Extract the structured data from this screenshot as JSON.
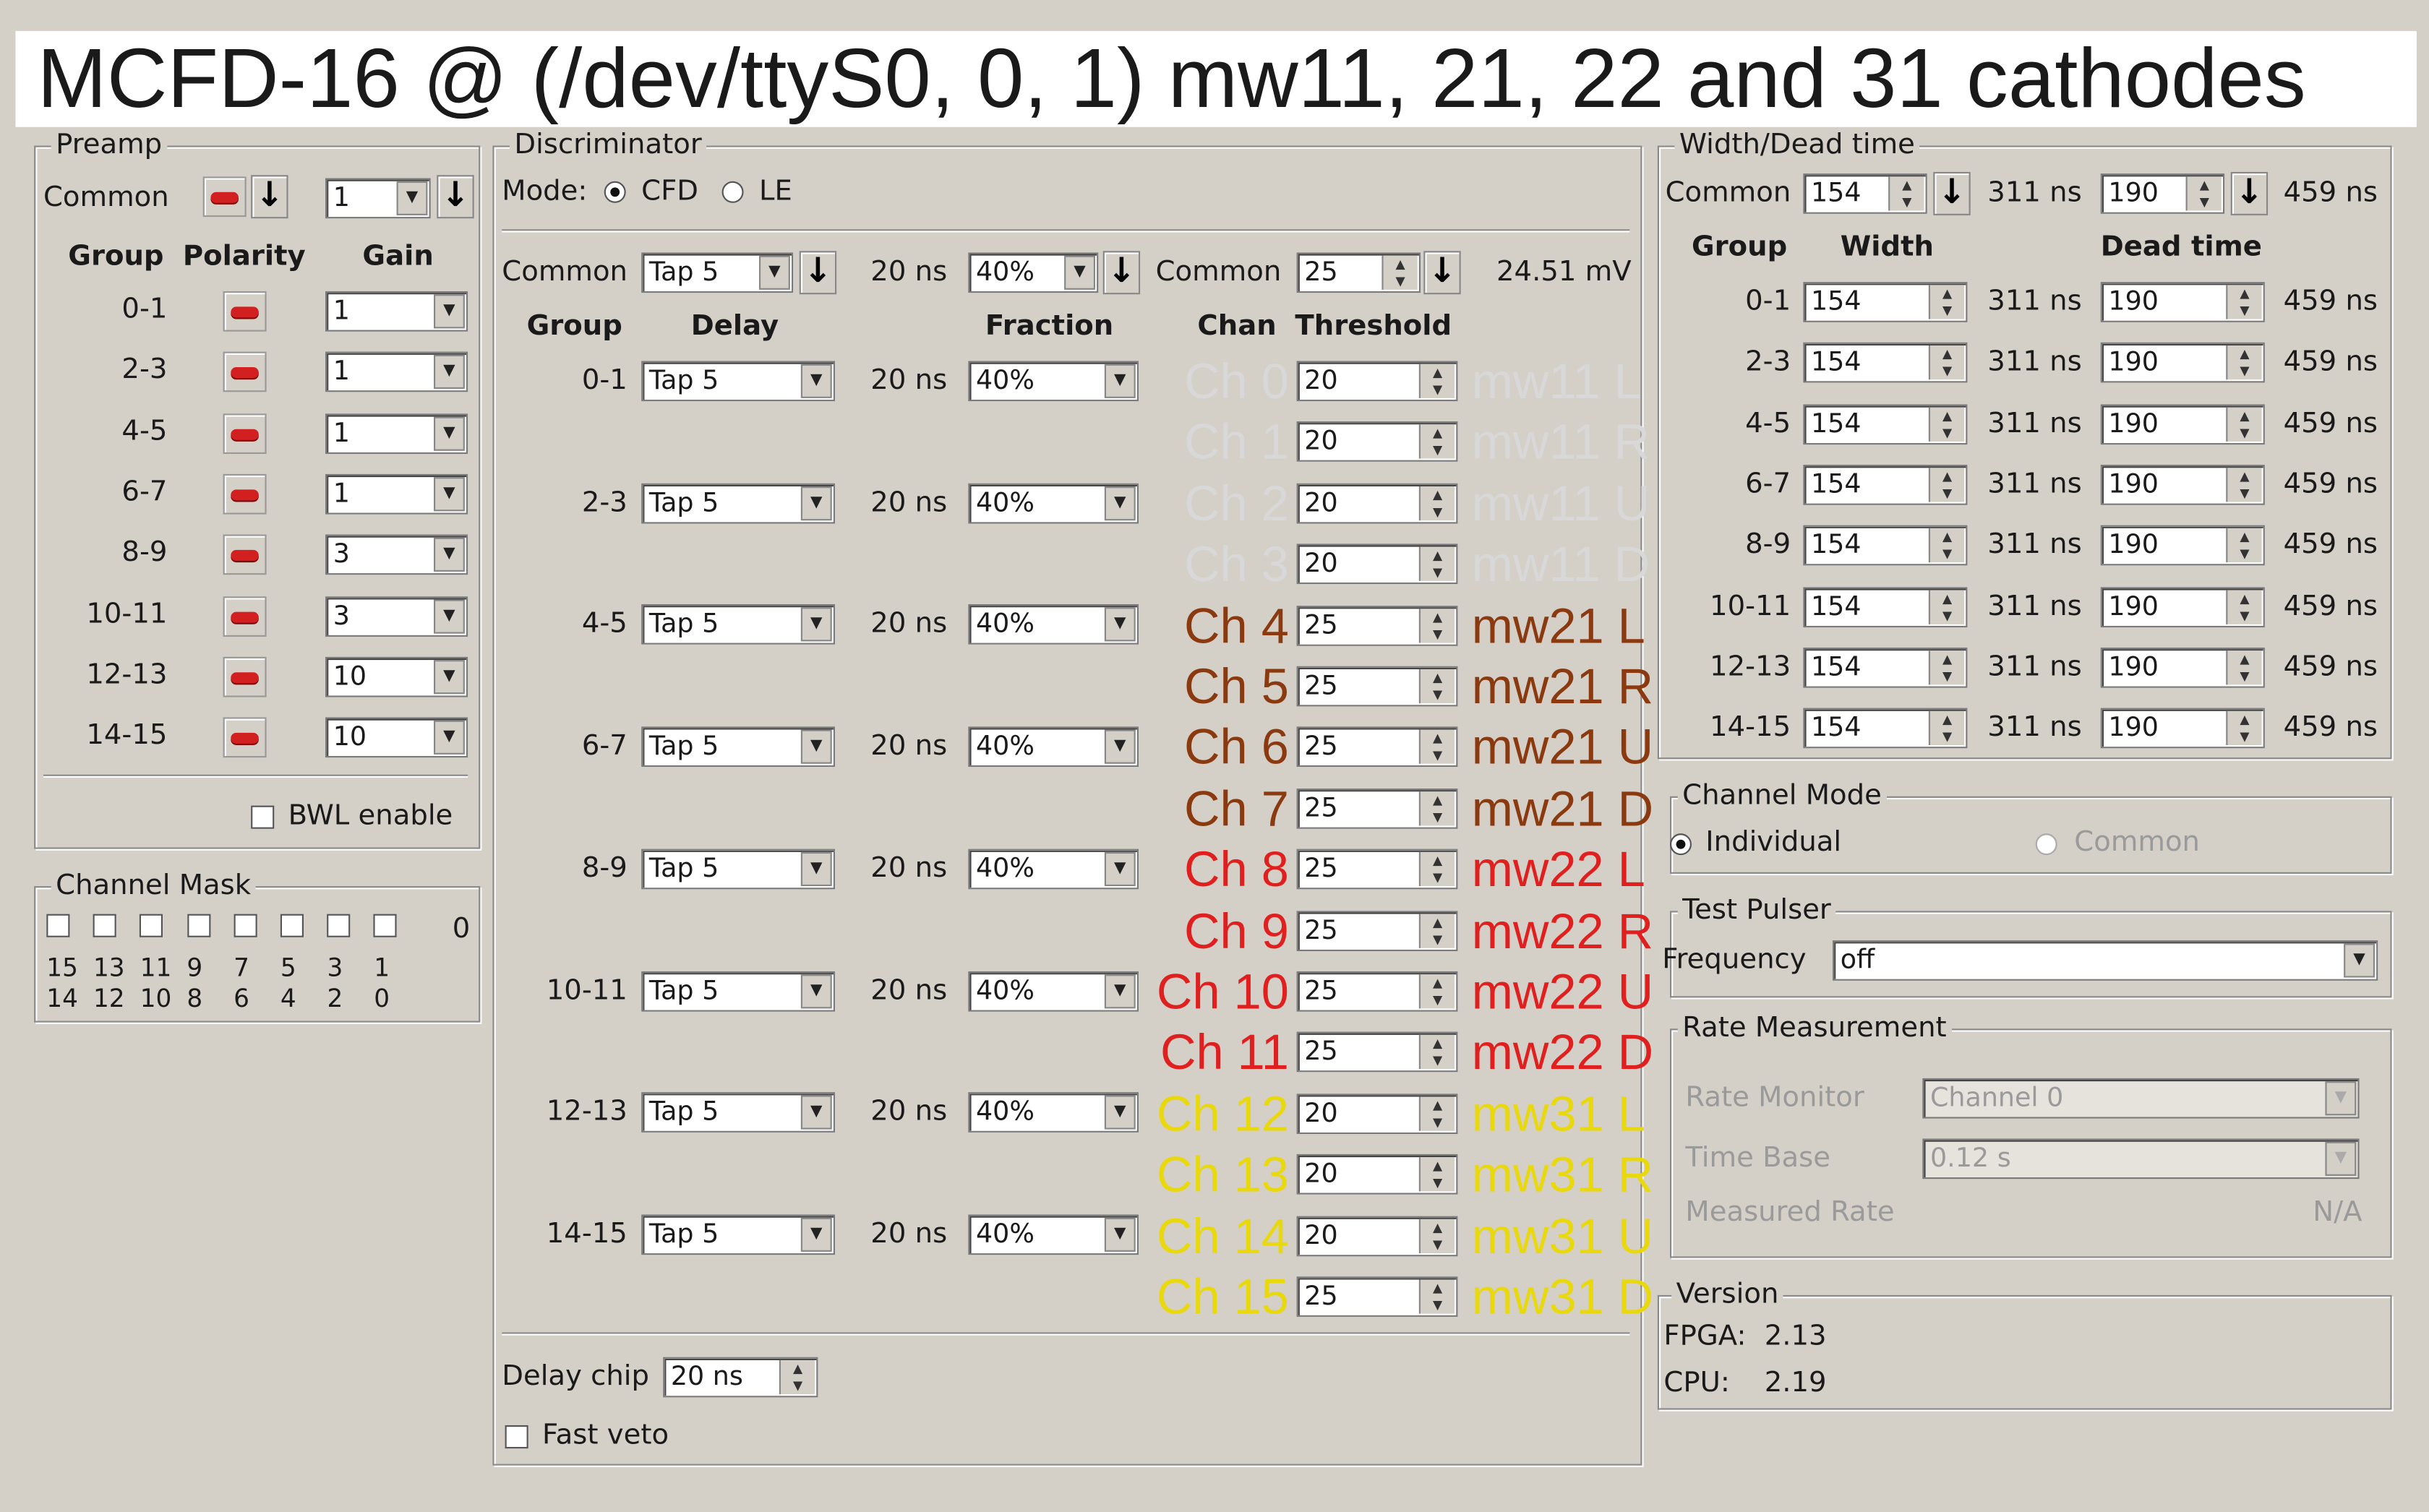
{
  "title": "MCFD-16 @ (/dev/ttyS0, 0, 1) mw11, 21, 22 and 31 cathodes",
  "preamp": {
    "title": "Preamp",
    "common_label": "Common",
    "common_gain": "1",
    "headers": [
      "Group",
      "Polarity",
      "Gain"
    ],
    "rows": [
      {
        "group": "0-1",
        "gain": "1"
      },
      {
        "group": "2-3",
        "gain": "1"
      },
      {
        "group": "4-5",
        "gain": "1"
      },
      {
        "group": "6-7",
        "gain": "1"
      },
      {
        "group": "8-9",
        "gain": "3"
      },
      {
        "group": "10-11",
        "gain": "3"
      },
      {
        "group": "12-13",
        "gain": "10"
      },
      {
        "group": "14-15",
        "gain": "10"
      }
    ],
    "bwl_label": "BWL enable"
  },
  "channel_mask": {
    "title": "Channel Mask",
    "value": "0",
    "top_numbers": [
      "15",
      "13",
      "11",
      "9",
      "7",
      "5",
      "3",
      "1"
    ],
    "bottom_numbers": [
      "14",
      "12",
      "10",
      "8",
      "6",
      "4",
      "2",
      "0"
    ]
  },
  "discriminator": {
    "title": "Discriminator",
    "mode_label": "Mode:",
    "mode_cfd": "CFD",
    "mode_le": "LE",
    "common_label": "Common",
    "common_delay": "Tap 5",
    "common_delay_ns": "20 ns",
    "common_fraction": "40%",
    "common_thr_label": "Common",
    "common_threshold": "25",
    "common_mv": "24.51 mV",
    "headers": {
      "group": "Group",
      "delay": "Delay",
      "fraction": "Fraction",
      "chan": "Chan",
      "threshold": "Threshold"
    },
    "groups": [
      {
        "group": "0-1",
        "delay": "Tap 5",
        "ns": "20 ns",
        "fraction": "40%"
      },
      {
        "group": "2-3",
        "delay": "Tap 5",
        "ns": "20 ns",
        "fraction": "40%"
      },
      {
        "group": "4-5",
        "delay": "Tap 5",
        "ns": "20 ns",
        "fraction": "40%"
      },
      {
        "group": "6-7",
        "delay": "Tap 5",
        "ns": "20 ns",
        "fraction": "40%"
      },
      {
        "group": "8-9",
        "delay": "Tap 5",
        "ns": "20 ns",
        "fraction": "40%"
      },
      {
        "group": "10-11",
        "delay": "Tap 5",
        "ns": "20 ns",
        "fraction": "40%"
      },
      {
        "group": "12-13",
        "delay": "Tap 5",
        "ns": "20 ns",
        "fraction": "40%"
      },
      {
        "group": "14-15",
        "delay": "Tap 5",
        "ns": "20 ns",
        "fraction": "40%"
      }
    ],
    "channels": [
      {
        "chan": "Ch 0",
        "threshold": "20",
        "name": "mw11 L",
        "color": "#d8d8d8"
      },
      {
        "chan": "Ch 1",
        "threshold": "20",
        "name": "mw11 R",
        "color": "#d8d8d8"
      },
      {
        "chan": "Ch 2",
        "threshold": "20",
        "name": "mw11 U",
        "color": "#d8d8d8"
      },
      {
        "chan": "Ch 3",
        "threshold": "20",
        "name": "mw11 D",
        "color": "#d8d8d8"
      },
      {
        "chan": "Ch 4",
        "threshold": "25",
        "name": "mw21 L",
        "color": "#8b3a10"
      },
      {
        "chan": "Ch 5",
        "threshold": "25",
        "name": "mw21 R",
        "color": "#8b3a10"
      },
      {
        "chan": "Ch 6",
        "threshold": "25",
        "name": "mw21 U",
        "color": "#8b3a10"
      },
      {
        "chan": "Ch 7",
        "threshold": "25",
        "name": "mw21 D",
        "color": "#8b3a10"
      },
      {
        "chan": "Ch 8",
        "threshold": "25",
        "name": "mw22 L",
        "color": "#e01f1f"
      },
      {
        "chan": "Ch 9",
        "threshold": "25",
        "name": "mw22 R",
        "color": "#e01f1f"
      },
      {
        "chan": "Ch 10",
        "threshold": "25",
        "name": "mw22 U",
        "color": "#e01f1f"
      },
      {
        "chan": "Ch 11",
        "threshold": "25",
        "name": "mw22 D",
        "color": "#e01f1f"
      },
      {
        "chan": "Ch 12",
        "threshold": "20",
        "name": "mw31 L",
        "color": "#e8d80c"
      },
      {
        "chan": "Ch 13",
        "threshold": "20",
        "name": "mw31 R",
        "color": "#e8d80c"
      },
      {
        "chan": "Ch 14",
        "threshold": "20",
        "name": "mw31 U",
        "color": "#e8d80c"
      },
      {
        "chan": "Ch 15",
        "threshold": "25",
        "name": "mw31 D",
        "color": "#e8d80c"
      }
    ],
    "delay_chip_label": "Delay chip",
    "delay_chip_value": "20 ns",
    "fast_veto_label": "Fast veto"
  },
  "width_dead": {
    "title": "Width/Dead time",
    "common_label": "Common",
    "common_width": "154",
    "common_width_ns": "311 ns",
    "common_dead": "190",
    "common_dead_ns": "459 ns",
    "headers": {
      "group": "Group",
      "width": "Width",
      "dead": "Dead time"
    },
    "rows": [
      {
        "group": "0-1",
        "width": "154",
        "wns": "311 ns",
        "dead": "190",
        "dns": "459 ns"
      },
      {
        "group": "2-3",
        "width": "154",
        "wns": "311 ns",
        "dead": "190",
        "dns": "459 ns"
      },
      {
        "group": "4-5",
        "width": "154",
        "wns": "311 ns",
        "dead": "190",
        "dns": "459 ns"
      },
      {
        "group": "6-7",
        "width": "154",
        "wns": "311 ns",
        "dead": "190",
        "dns": "459 ns"
      },
      {
        "group": "8-9",
        "width": "154",
        "wns": "311 ns",
        "dead": "190",
        "dns": "459 ns"
      },
      {
        "group": "10-11",
        "width": "154",
        "wns": "311 ns",
        "dead": "190",
        "dns": "459 ns"
      },
      {
        "group": "12-13",
        "width": "154",
        "wns": "311 ns",
        "dead": "190",
        "dns": "459 ns"
      },
      {
        "group": "14-15",
        "width": "154",
        "wns": "311 ns",
        "dead": "190",
        "dns": "459 ns"
      }
    ]
  },
  "channel_mode": {
    "title": "Channel Mode",
    "individual": "Individual",
    "common": "Common"
  },
  "test_pulser": {
    "title": "Test Pulser",
    "frequency_label": "Frequency",
    "frequency_value": "off"
  },
  "rate": {
    "title": "Rate Measurement",
    "monitor_label": "Rate Monitor",
    "monitor_value": "Channel 0",
    "timebase_label": "Time Base",
    "timebase_value": "0.12 s",
    "measured_label": "Measured Rate",
    "measured_value": "N/A"
  },
  "version": {
    "title": "Version",
    "fpga_label": "FPGA:",
    "fpga_value": "2.13",
    "cpu_label": "CPU:",
    "cpu_value": "2.19"
  }
}
